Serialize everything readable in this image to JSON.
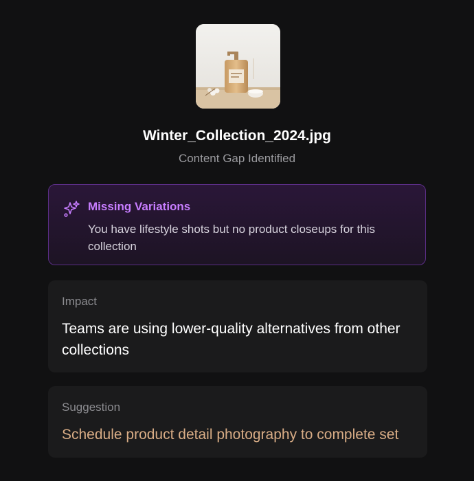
{
  "file": {
    "name": "Winter_Collection_2024.jpg",
    "status": "Content Gap Identified",
    "thumbnail_icon": "product-photo-thumbnail"
  },
  "alert": {
    "icon": "sparkles-icon",
    "title": "Missing Variations",
    "description": "You have lifestyle shots but no product closeups for this collection",
    "accent_color": "#c77dff",
    "border_color": "#5b2e86"
  },
  "impact": {
    "label": "Impact",
    "text": "Teams are using lower-quality alternatives from other collections"
  },
  "suggestion": {
    "label": "Suggestion",
    "text": "Schedule product detail photography to complete set",
    "text_color": "#d9ad86"
  }
}
